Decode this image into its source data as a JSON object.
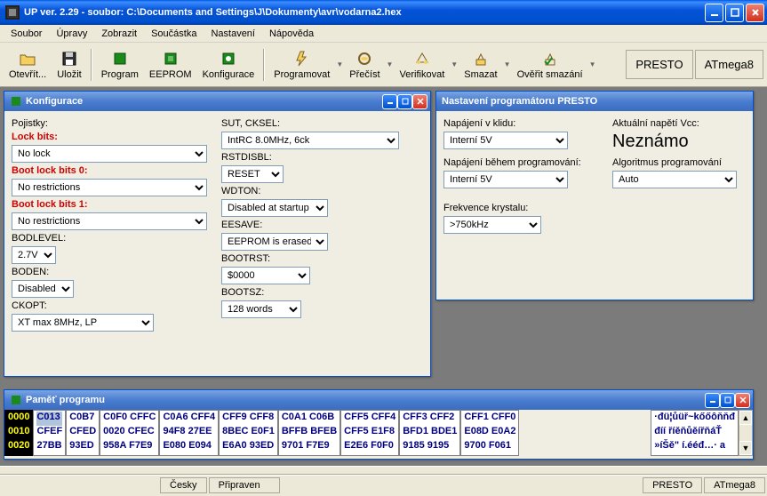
{
  "window": {
    "title": "UP ver. 2.29 - soubor: C:\\Documents and Settings\\J\\Dokumenty\\avr\\vodarna2.hex"
  },
  "menu": {
    "soubor": "Soubor",
    "upravy": "Úpravy",
    "zobrazit": "Zobrazit",
    "soucastka": "Součástka",
    "nastaveni": "Nastavení",
    "napoveda": "Nápověda"
  },
  "toolbar": {
    "otevrit": "Otevřít...",
    "ulozit": "Uložit",
    "program": "Program",
    "eeprom": "EEPROM",
    "konfigurace": "Konfigurace",
    "programovat": "Programovat",
    "precist": "Přečíst",
    "verifikovat": "Verifikovat",
    "smazat": "Smazat",
    "overit_smazani": "Ověřit smazání",
    "presto": "PRESTO",
    "chip": "ATmega8"
  },
  "config_win": {
    "title": "Konfigurace",
    "pojistky": "Pojistky:",
    "lock_bits_lbl": "Lock bits:",
    "lock_bits_val": "No lock",
    "boot_lock0_lbl": "Boot lock bits 0:",
    "boot_lock0_val": "No restrictions",
    "boot_lock1_lbl": "Boot lock bits 1:",
    "boot_lock1_val": "No restrictions",
    "bodlevel_lbl": "BODLEVEL:",
    "bodlevel_val": "2.7V",
    "boden_lbl": "BODEN:",
    "boden_val": "Disabled",
    "ckopt_lbl": "CKOPT:",
    "ckopt_val": "XT max 8MHz, LP",
    "sut_lbl": "SUT, CKSEL:",
    "sut_val": "IntRC 8.0MHz, 6ck",
    "rstdisbl_lbl": "RSTDISBL:",
    "rstdisbl_val": "RESET",
    "wdton_lbl": "WDTON:",
    "wdton_val": "Disabled at startup",
    "eesave_lbl": "EESAVE:",
    "eesave_val": "EEPROM is erased",
    "bootrst_lbl": "BOOTRST:",
    "bootrst_val": "$0000",
    "bootsz_lbl": "BOOTSZ:",
    "bootsz_val": "128 words"
  },
  "presto_win": {
    "title": "Nastavení programátoru PRESTO",
    "napajeni_klid_lbl": "Napájení v klidu:",
    "napajeni_klid_val": "Interní 5V",
    "napajeni_prog_lbl": "Napájení během programování:",
    "napajeni_prog_val": "Interní 5V",
    "frekvence_lbl": "Frekvence krystalu:",
    "frekvence_val": ">750kHz",
    "vcc_lbl": "Aktuální napětí Vcc:",
    "vcc_val": "Neznámo",
    "alg_lbl": "Algoritmus programování",
    "alg_val": "Auto"
  },
  "mem_win": {
    "title": "Paměť programu",
    "addr": [
      "0000",
      "0010",
      "0020"
    ],
    "cols": [
      [
        "C013",
        "CFEF",
        "27BB"
      ],
      [
        "C0B7",
        "CFED",
        "93ED"
      ],
      [
        "C0F0 CFFC",
        "0020 CFEC",
        "958A F7E9"
      ],
      [
        "C0A6 CFF4",
        "94F8 27EE",
        "E080 E094"
      ],
      [
        "CFF9 CFF8",
        "8BEC E0F1",
        "E6A0 93ED"
      ],
      [
        "C0A1 C06B",
        "BFFB BFEB",
        "9701 F7E9"
      ],
      [
        "CFF5 CFF4",
        "CFF5 E1F8",
        "E2E6 F0F0"
      ],
      [
        "CFF3 CFF2",
        "BFD1 BDE1",
        "9185 9195"
      ],
      [
        "CFF1 CFF0",
        "E08D E0A2",
        "9700 F061"
      ]
    ],
    "ascii": [
      "·đü¦ůüř~kőőôňňđ",
      "đíí říěňůěířňáŤ",
      "»íŠě\" í.ééđ…· a"
    ]
  },
  "status": {
    "cesky": "Česky",
    "pripraven": "Připraven",
    "presto": "PRESTO",
    "chip": "ATmega8"
  }
}
